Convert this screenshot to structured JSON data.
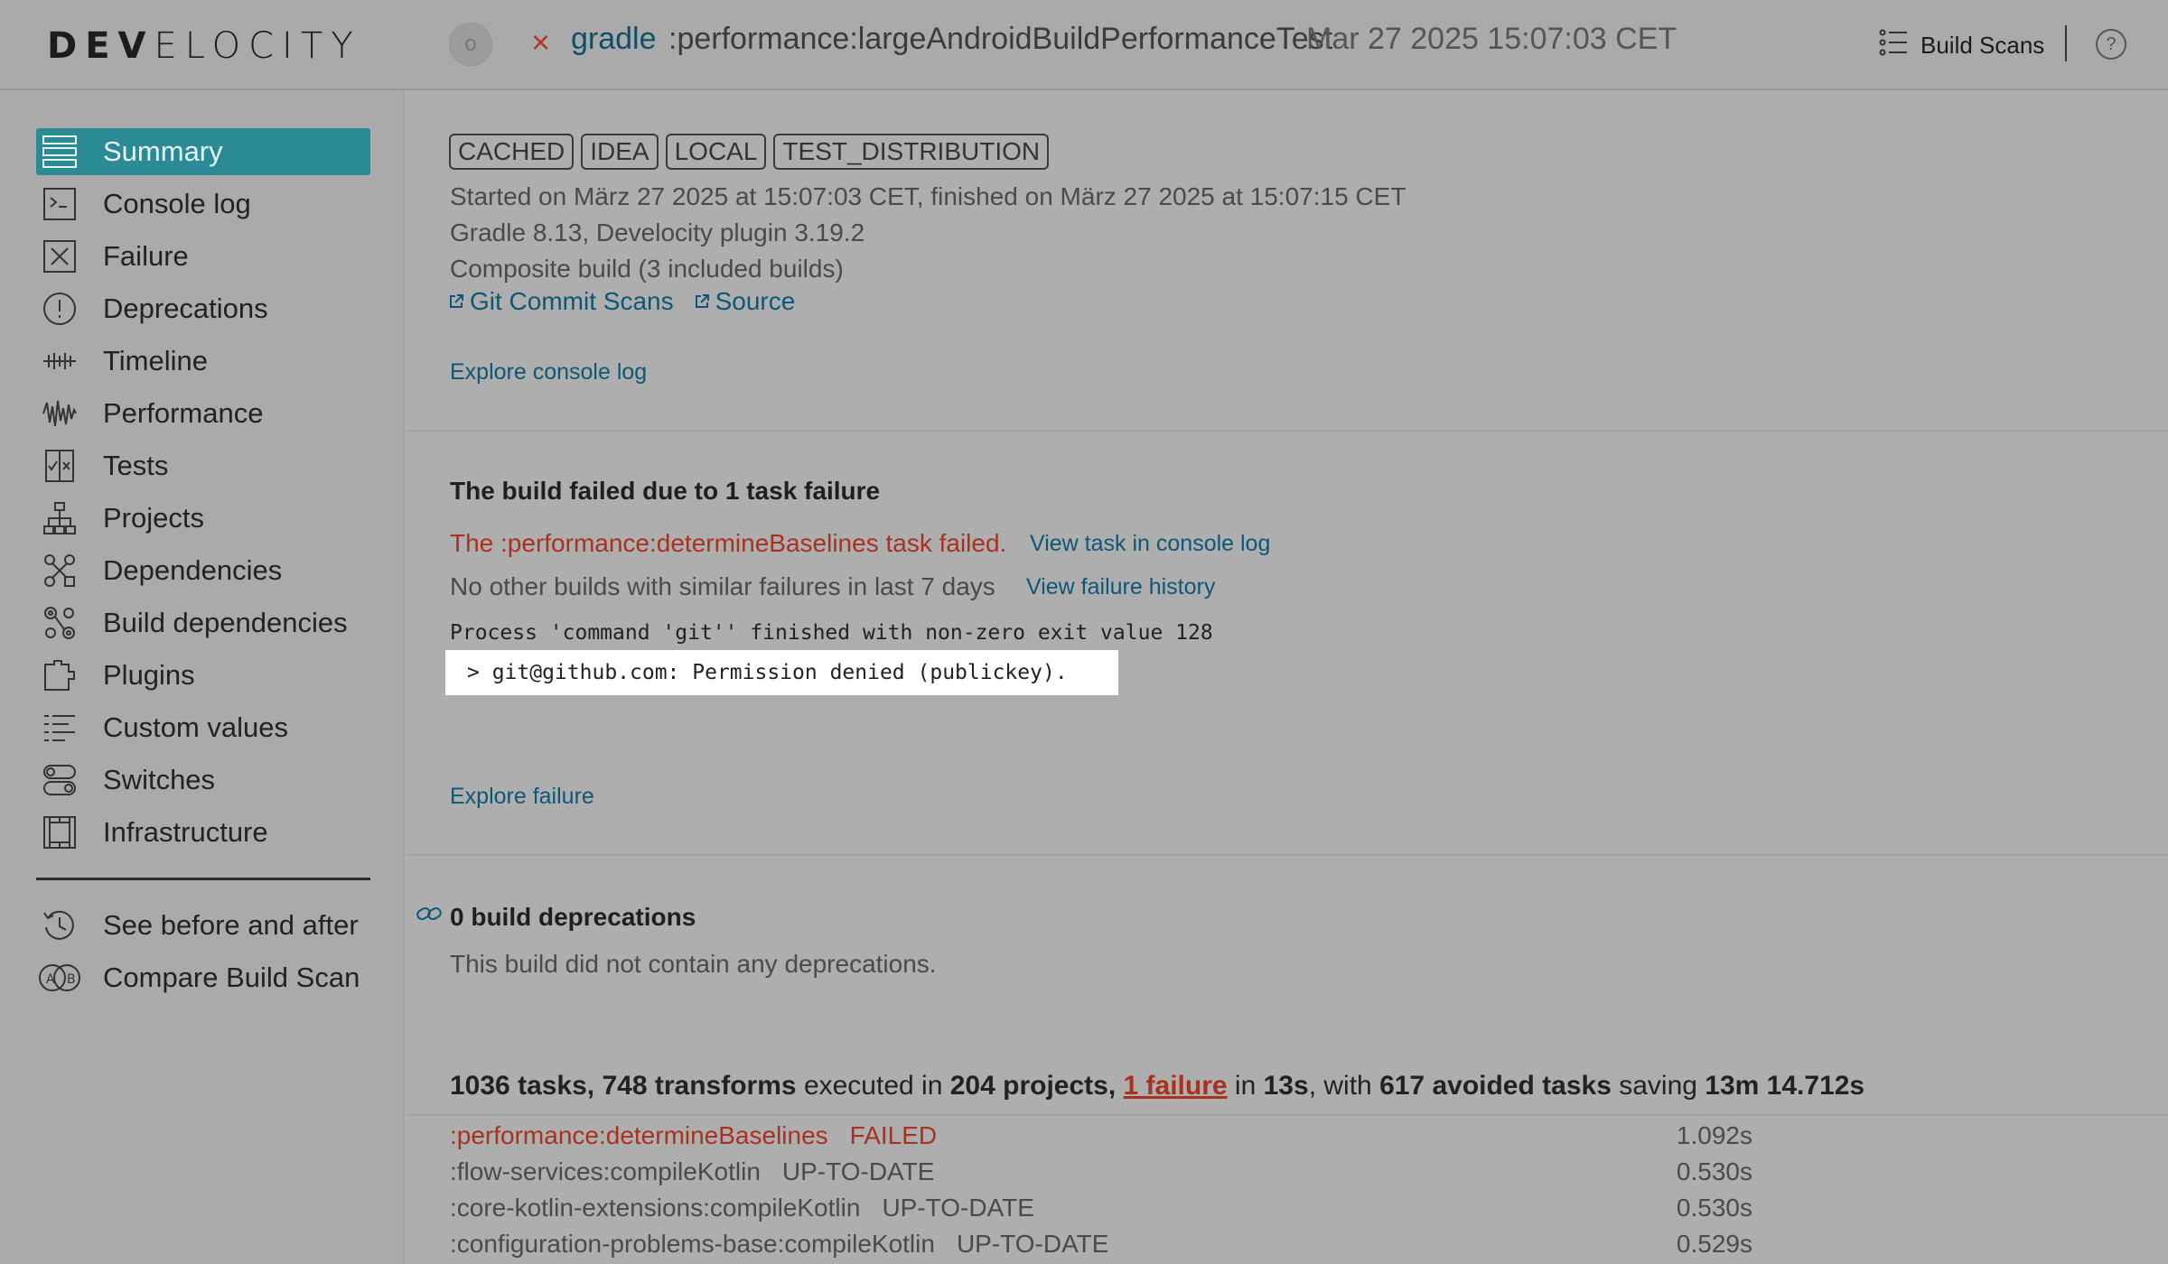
{
  "header": {
    "logo": {
      "bold": "DEV",
      "rest": "ELOCITY"
    },
    "status_glyph": "o",
    "fail_glyph": "×",
    "project": "gradle",
    "task_path": ":performance:largeAndroidBuildPerformanceTest",
    "time": "Mar 27 2025 15:07:03 CET",
    "build_scans_label": "Build Scans",
    "help_glyph": "?"
  },
  "sidebar": {
    "items": [
      {
        "label": "Summary",
        "icon": "summary-icon"
      },
      {
        "label": "Console log",
        "icon": "console-icon"
      },
      {
        "label": "Failure",
        "icon": "failure-icon"
      },
      {
        "label": "Deprecations",
        "icon": "deprecations-icon"
      },
      {
        "label": "Timeline",
        "icon": "timeline-icon"
      },
      {
        "label": "Performance",
        "icon": "performance-icon"
      },
      {
        "label": "Tests",
        "icon": "tests-icon"
      },
      {
        "label": "Projects",
        "icon": "projects-icon"
      },
      {
        "label": "Dependencies",
        "icon": "dependencies-icon"
      },
      {
        "label": "Build dependencies",
        "icon": "build-dependencies-icon"
      },
      {
        "label": "Plugins",
        "icon": "plugins-icon"
      },
      {
        "label": "Custom values",
        "icon": "custom-values-icon"
      },
      {
        "label": "Switches",
        "icon": "switches-icon"
      },
      {
        "label": "Infrastructure",
        "icon": "infrastructure-icon"
      }
    ],
    "extra": [
      {
        "label": "See before and after",
        "icon": "history-icon"
      },
      {
        "label": "Compare Build Scan",
        "icon": "compare-icon"
      }
    ]
  },
  "overview": {
    "tags": [
      "CACHED",
      "IDEA",
      "LOCAL",
      "TEST_DISTRIBUTION"
    ],
    "started": "Started on März 27 2025 at 15:07:03 CET, finished on März 27 2025 at 15:07:15 CET",
    "versions": "Gradle 8.13,  Develocity plugin 3.19.2",
    "composite": "Composite build (3 included builds)",
    "git_commit_scans": "Git Commit Scans",
    "source": "Source",
    "explore_console": "Explore console log"
  },
  "failure": {
    "heading": "The build failed due to 1 task failure",
    "task_failed": "The :performance:determineBaselines task failed.",
    "view_task": "View task in console log",
    "no_similar": "No other builds with similar failures in last 7 days",
    "view_history": "View failure history",
    "message_line1": "Process 'command 'git'' finished with non-zero exit value 128",
    "message_line2": "> git@github.com: Permission denied (publickey).",
    "explore_failure": "Explore failure"
  },
  "deprecations": {
    "heading": "0 build deprecations",
    "text": "This build did not contain any deprecations."
  },
  "tasks": {
    "count": "1036 tasks,",
    "transforms": "748 transforms",
    "executed_in": "executed in",
    "projects": "204 projects,",
    "failures": "1 failure",
    "in": "in",
    "duration": "13s",
    "with": ", with",
    "avoided": "617 avoided tasks",
    "saving": "saving",
    "saved": "13m 14.712s",
    "rows": [
      {
        "path": ":performance:determineBaselines",
        "outcome": "FAILED",
        "duration": "1.092s"
      },
      {
        "path": ":flow-services:compileKotlin",
        "outcome": "UP-TO-DATE",
        "duration": "0.530s"
      },
      {
        "path": ":core-kotlin-extensions:compileKotlin",
        "outcome": "UP-TO-DATE",
        "duration": "0.530s"
      },
      {
        "path": ":configuration-problems-base:compileKotlin",
        "outcome": "UP-TO-DATE",
        "duration": "0.529s"
      }
    ]
  },
  "colors": {
    "accent": "#2a8b97",
    "link": "#0e5776",
    "failure": "#a8321f",
    "background": "#aeaeae"
  }
}
